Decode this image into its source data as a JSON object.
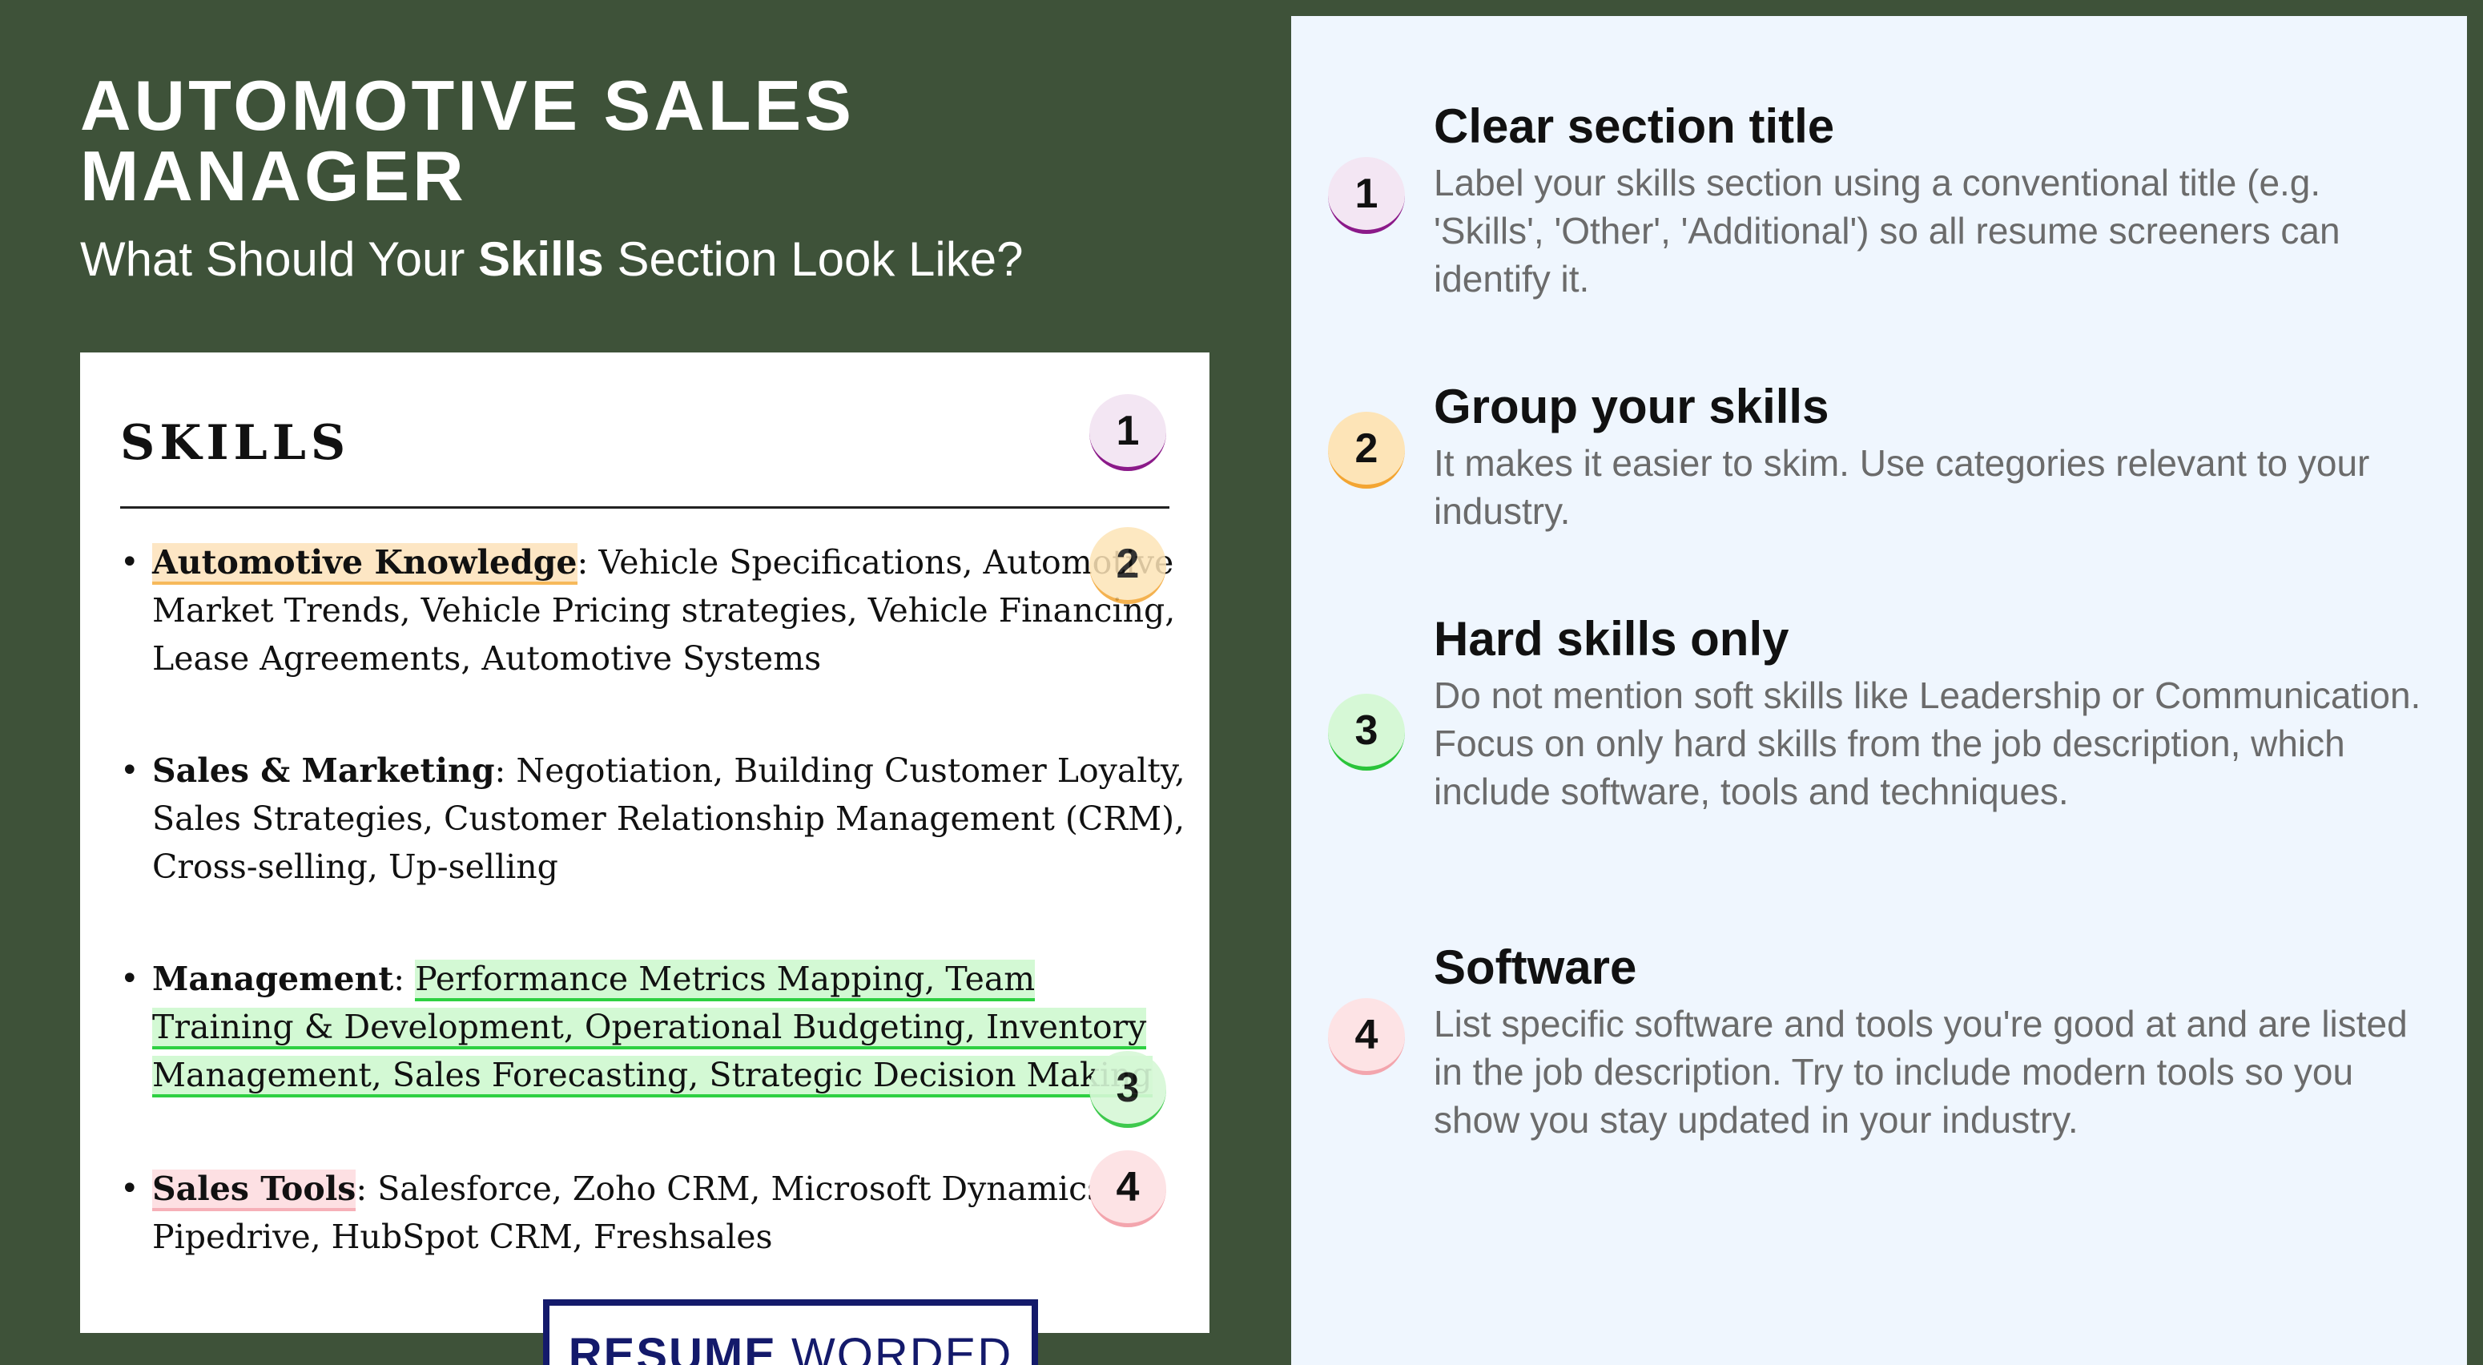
{
  "header": {
    "title_line1": "AUTOMOTIVE SALES",
    "title_line2": "MANAGER",
    "subtitle_before": "What Should Your ",
    "subtitle_bold": "Skills",
    "subtitle_after": " Section Look Like?"
  },
  "resume": {
    "section_title": "SKILLS",
    "items": [
      {
        "category": "Automotive Knowledge",
        "details": ": Vehicle Specifications, Automotive Market Trends, Vehicle Pricing strategies, Vehicle Financing, Lease Agreements, Automotive Systems"
      },
      {
        "category": "Sales & Marketing",
        "details": ": Negotiation, Building Customer Loyalty, Sales Strategies, Customer Relationship Management (CRM), Cross-selling, Up-selling"
      },
      {
        "category": "Management",
        "sep": ": ",
        "details": "Performance Metrics Mapping, Team Training & Development, Operational Budgeting, Inventory Management, Sales Forecasting, Strategic Decision Making"
      },
      {
        "category": "Sales Tools",
        "details": ": Salesforce, Zoho CRM, Microsoft Dynamics, Pipedrive, HubSpot CRM, Freshsales"
      }
    ]
  },
  "badges": [
    "1",
    "2",
    "3",
    "4"
  ],
  "logo": {
    "bold": "RESUME",
    "regular": " WORDED"
  },
  "tips": [
    {
      "number": "1",
      "title": "Clear section title",
      "text": "Label your skills section using a conventional title (e.g. 'Skills', 'Other', 'Additional') so all resume screeners can identify it."
    },
    {
      "number": "2",
      "title": "Group your skills",
      "text": "It makes it easier to skim. Use categories relevant to your industry."
    },
    {
      "number": "3",
      "title": "Hard skills only",
      "text": "Do not mention soft skills like Leadership or Communication. Focus on only hard skills from the job description, which include software, tools and techniques."
    },
    {
      "number": "4",
      "title": "Software",
      "text": "List specific software and tools you're good at and are listed in the job description. Try to include modern tools so you show you stay updated in your industry."
    }
  ],
  "colors": {
    "background": "#3e5239",
    "panel": "#eff6fe",
    "badge1": "#8b1a89",
    "badge2": "#f3a532",
    "badge3": "#2ac43a",
    "badge4": "#f3a5ad",
    "logo": "#141a6b"
  }
}
